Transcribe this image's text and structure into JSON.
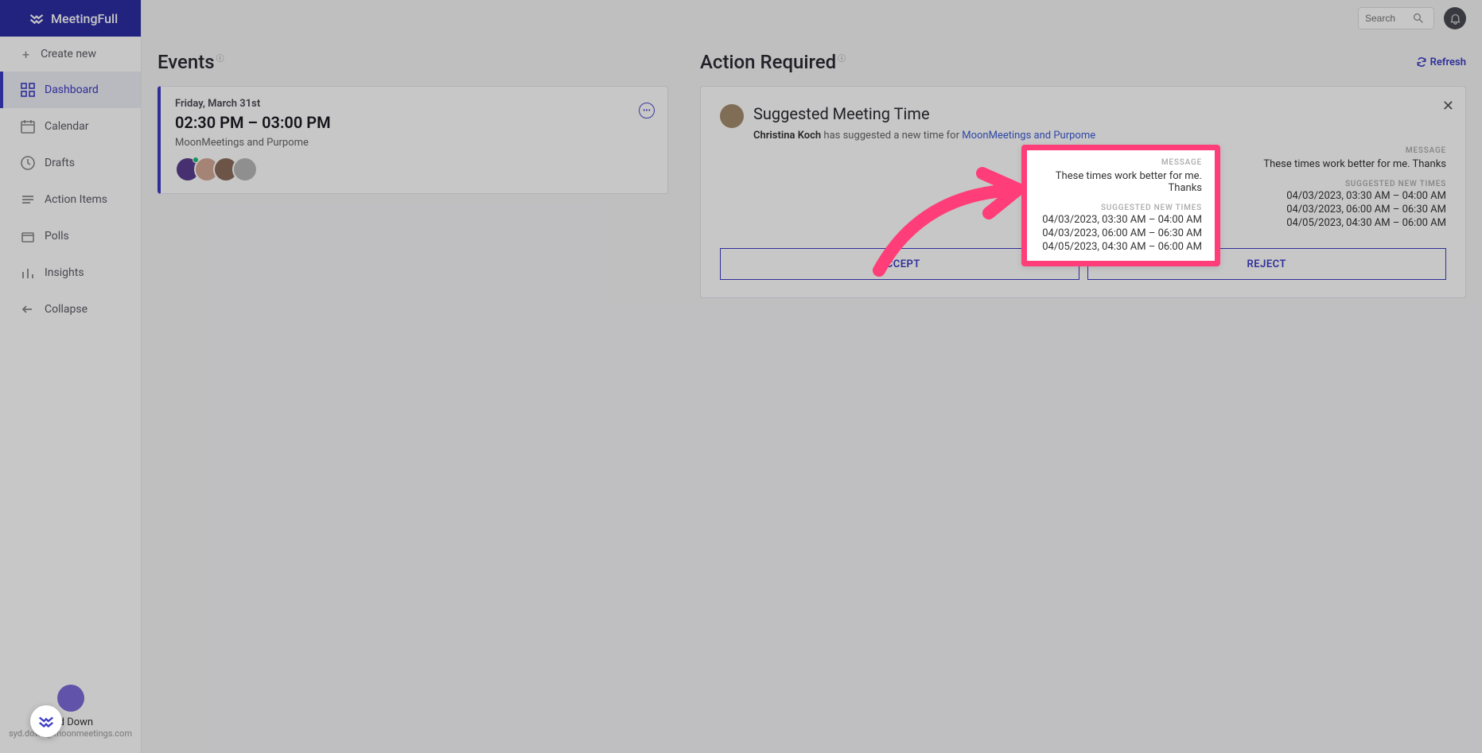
{
  "brand": {
    "name": "MeetingFull"
  },
  "sidebar": {
    "create": "Create new",
    "items": [
      {
        "label": "Dashboard",
        "icon": "grid"
      },
      {
        "label": "Calendar",
        "icon": "calendar"
      },
      {
        "label": "Drafts",
        "icon": "clock"
      },
      {
        "label": "Action Items",
        "icon": "lines"
      },
      {
        "label": "Polls",
        "icon": "box"
      },
      {
        "label": "Insights",
        "icon": "bars"
      },
      {
        "label": "Collapse",
        "icon": "arrow-left"
      }
    ]
  },
  "header": {
    "search_placeholder": "Search"
  },
  "events": {
    "title": "Events",
    "card": {
      "date": "Friday, March 31st",
      "time": "02:30 PM – 03:00 PM",
      "meeting": "MoonMeetings and Purpome"
    }
  },
  "action": {
    "title": "Action Required",
    "refresh": "Refresh",
    "card": {
      "heading": "Suggested Meeting Time",
      "suggester": "Christina Koch",
      "verb": " has suggested a new time for ",
      "meeting": "MoonMeetings and Purpome",
      "message_label": "MESSAGE",
      "message": "These times work better for me. Thanks",
      "times_label": "SUGGESTED NEW TIMES",
      "times": [
        "04/03/2023, 03:30 AM – 04:00 AM",
        "04/03/2023, 06:00 AM – 06:30 AM",
        "04/05/2023, 04:30 AM – 06:00 AM"
      ],
      "accept": "ACCEPT",
      "reject": "REJECT"
    }
  },
  "user": {
    "name": "Syd Down",
    "email": "syd.down@moonmeetings.com"
  }
}
